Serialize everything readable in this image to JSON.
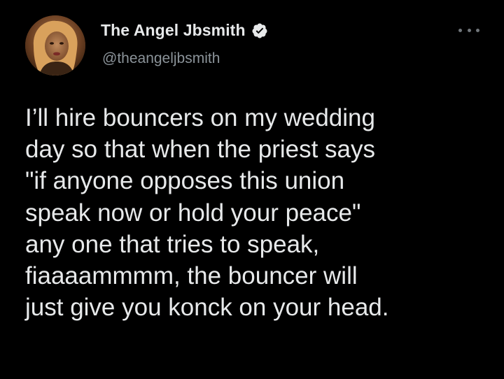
{
  "tweet": {
    "author": {
      "display_name": "The Angel Jbsmith",
      "handle": "@theangeljbsmith",
      "verified": true,
      "avatar_icon": "profile-photo"
    },
    "text_lines": [
      "I’ll hire bouncers on my wedding",
      "day so that when the priest says",
      "\"if anyone opposes this union",
      "speak now or hold your peace\"",
      "any one that tries to speak,",
      "fiaaaammmm, the bouncer will",
      "just give you konck on your head."
    ],
    "menu_icon": "more-horizontal-icon"
  },
  "colors": {
    "background": "#000000",
    "text": "#e7e9ea",
    "secondary_text": "#8b9399",
    "verified_badge": "#e7e9ea"
  }
}
